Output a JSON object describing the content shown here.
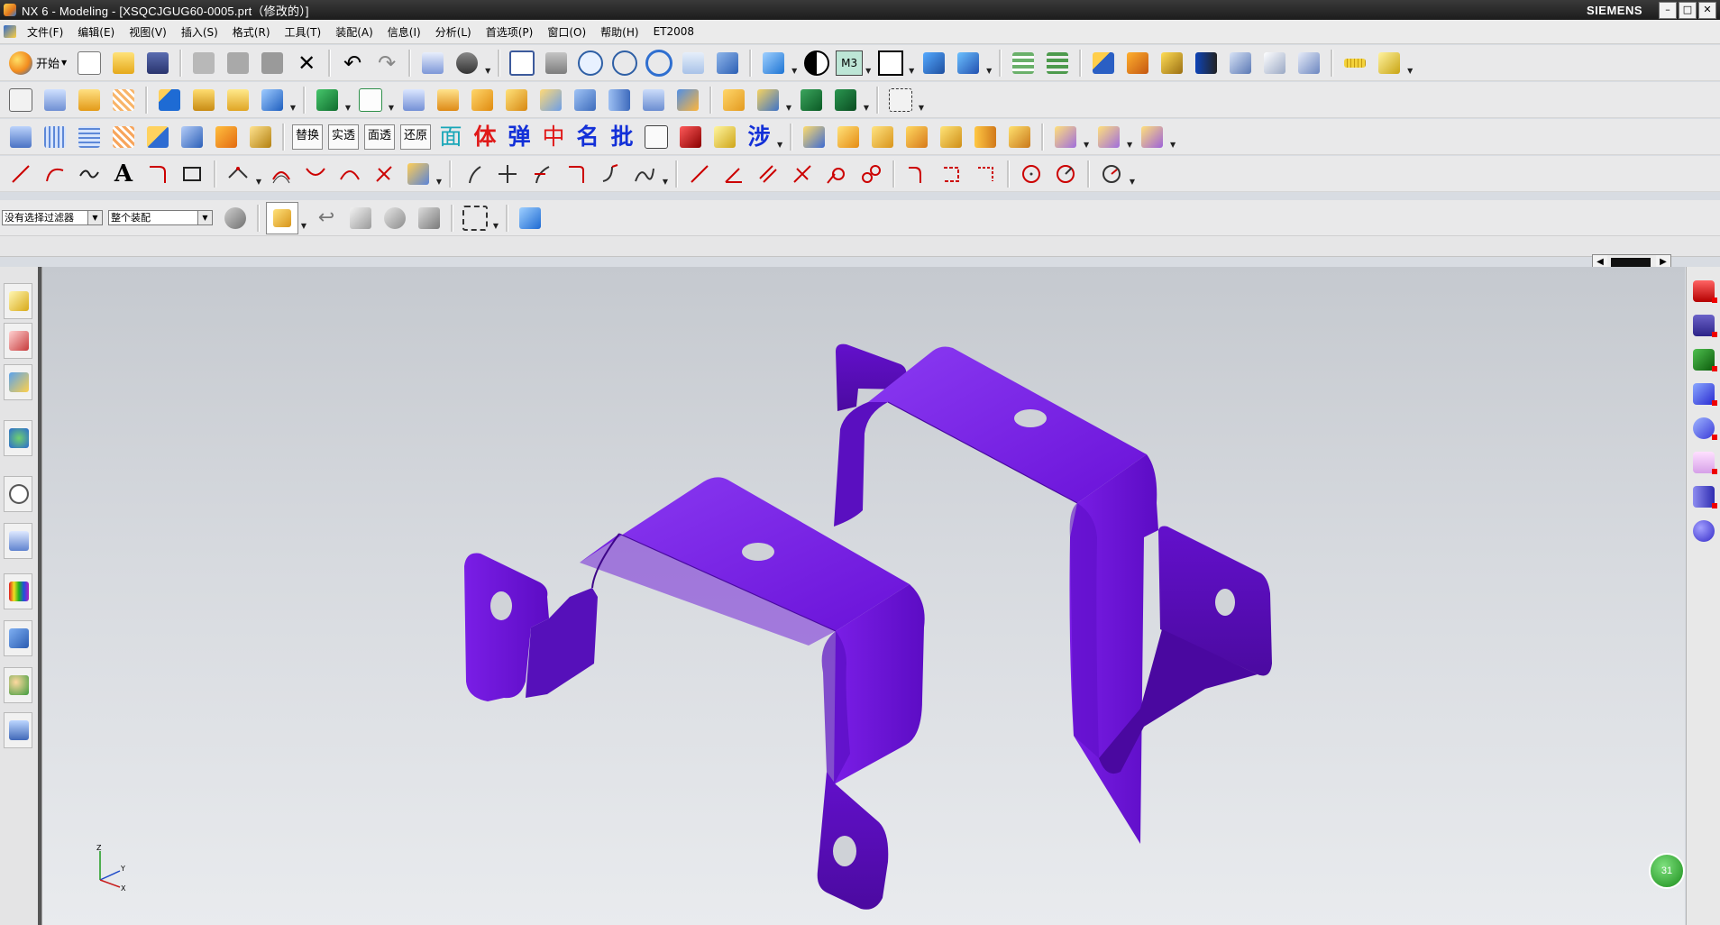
{
  "window": {
    "title": "NX 6 - Modeling - [XSQCJGUG60-0005.prt（修改的）]",
    "brand": "SIEMENS"
  },
  "menubar": {
    "items": [
      "文件(F)",
      "编辑(E)",
      "视图(V)",
      "插入(S)",
      "格式(R)",
      "工具(T)",
      "装配(A)",
      "信息(I)",
      "分析(L)",
      "首选项(P)",
      "窗口(O)",
      "帮助(H)",
      "ET2008"
    ]
  },
  "toolbar1": {
    "start_label": "开始",
    "layer_label": "M3"
  },
  "toolbar3": {
    "text_buttons": [
      "替换",
      "实透",
      "面透",
      "还原"
    ],
    "big_chars": [
      "面",
      "体",
      "弹",
      "中",
      "名",
      "批"
    ],
    "big_char_colors": [
      "#18a6b8",
      "#e01818",
      "#1330d8",
      "#e01818",
      "#1330d8",
      "#1330d8"
    ],
    "wave_char": "涉"
  },
  "selection": {
    "filter_value": "没有选择过滤器",
    "scope_value": "整个装配"
  },
  "graphics": {
    "part_color": "#7a1ee6",
    "triad_labels": [
      "Z",
      "Y",
      "X"
    ]
  },
  "status": {
    "badge_text": "31"
  },
  "icons": {
    "toolbar1": [
      "new-file-icon",
      "open-folder-icon",
      "save-icon",
      "cut-icon",
      "copy-icon",
      "paste-icon",
      "delete-icon",
      "undo-icon",
      "redo-icon",
      "info-icon",
      "binoculars-icon",
      "fit-icon",
      "zoom-window-icon",
      "zoom-icon",
      "rotate-icon",
      "pan-icon",
      "orient-view-icon",
      "shaded-cube-icon",
      "render-style-icon",
      "layer-icon",
      "white-box-icon",
      "wcs-icon",
      "csys-icon",
      "layer-settings-icon",
      "move-layer-icon",
      "point-icon",
      "datum-icon",
      "vector-icon",
      "arrow-icon",
      "plane-icon",
      "cursor-icon",
      "measure-icon",
      "ruler-icon",
      "angle-icon"
    ],
    "toolbar2": [
      "sketch-icon",
      "extrude-icon",
      "revolve-icon",
      "sweep-icon",
      "block-icon",
      "hole-icon",
      "boss-icon",
      "pocket-icon",
      "pad-icon",
      "slot-icon",
      "groove-icon",
      "feature-ops-icon",
      "blend-icon",
      "chamfer-icon",
      "shell-icon",
      "draft-icon",
      "trim-icon",
      "split-icon",
      "offset-icon",
      "scale-icon",
      "thicken-icon",
      "pattern-icon",
      "mirror-icon",
      "unite-icon",
      "subtract-icon",
      "intersect-icon"
    ],
    "toolbar4": [
      "line-icon",
      "arc-icon",
      "spline-icon",
      "text-icon",
      "fillet-icon",
      "rectangle-icon",
      "point-set-icon",
      "curve-offset-icon",
      "bridge-icon",
      "join-icon",
      "project-icon",
      "intersect-curve-icon",
      "edit-curve-icon",
      "trim-curve-icon",
      "extend-curve-icon",
      "divide-icon",
      "length-icon",
      "circle-icon",
      "dimension-icon",
      "gauge-icon"
    ],
    "right_palette": [
      "key-icon",
      "t-icon",
      "green-block-icon",
      "blue-part-icon",
      "heart-part-icon",
      "cup-icon",
      "pin-icon",
      "blue-knob-icon"
    ],
    "left_resource": [
      "assembly-navigator-icon",
      "constraint-navigator-icon",
      "part-navigator-icon",
      "web-browser-icon",
      "history-icon",
      "system-materials-icon",
      "palette-icon",
      "roles-icon",
      "users-icon",
      "systems-icon"
    ]
  }
}
